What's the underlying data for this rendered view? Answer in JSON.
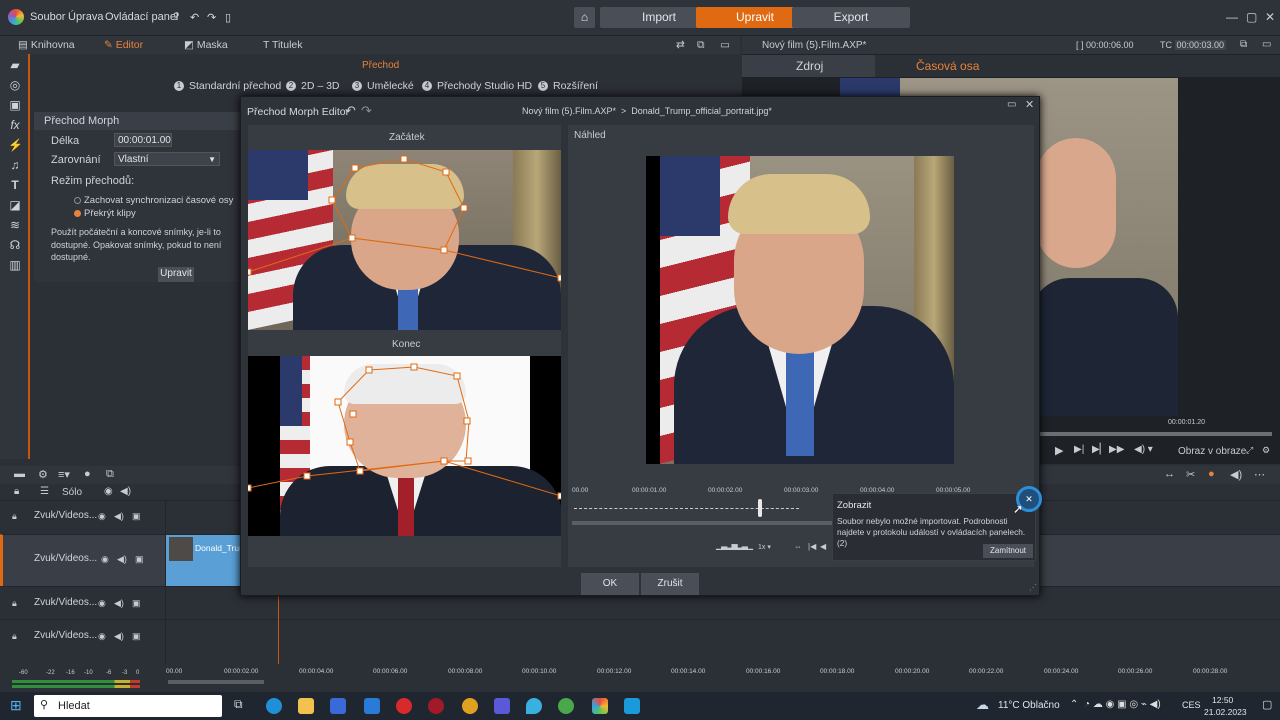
{
  "menu": {
    "file": "Soubor",
    "edit": "Úprava",
    "control_panel": "Ovládací panel"
  },
  "modes": {
    "import": "Import",
    "edit": "Upravit",
    "export": "Export"
  },
  "tabs": {
    "library": "Knihovna",
    "editor": "Editor",
    "mask": "Maska",
    "title": "Titulek"
  },
  "transition_label": "Přechod",
  "subtabs": [
    {
      "num": "1",
      "label": "Standardní přechod"
    },
    {
      "num": "2",
      "label": "2D – 3D"
    },
    {
      "num": "3",
      "label": "Umělecké"
    },
    {
      "num": "4",
      "label": "Přechody Studio HD"
    },
    {
      "num": "5",
      "label": "Rozšíření"
    }
  ],
  "props": {
    "header": "Přechod Morph",
    "length_label": "Délka",
    "length_value": "00:00:01.00",
    "align_label": "Zarovnání",
    "align_value": "Vlastní",
    "mode_label": "Režim přechodů:",
    "opt1": "Zachovat synchronizaci časové osy",
    "opt2": "Překrýt klipy",
    "note": "Použít počáteční a koncové snímky, je-li to dostupné. Opakovat snímky, pokud to není dostupné.",
    "edit_btn": "Upravit"
  },
  "preview": {
    "title": "Nový film (5).Film.AXP*",
    "timecode1": "00:00:06.00",
    "tc_label": "TC",
    "timecode2": "00:00:03.00",
    "tab_source": "Zdroj",
    "tab_timeline": "Časová osa",
    "time": "00:00:01.20",
    "view_label": "Obraz v obraze"
  },
  "dialog": {
    "title": "Přechod Morph Editor",
    "crumb1": "Nový film (5).Film.AXP*",
    "crumb2": "Donald_Trump_official_portrait.jpg*",
    "start_label": "Začátek",
    "end_label": "Konec",
    "preview_label": "Náhled",
    "ticks": [
      "00.00",
      "00:00:01.00",
      "00:00:02.00",
      "00:00:03.00",
      "00:00:04.00",
      "00:00:05.00"
    ],
    "speed": "1x",
    "ok": "OK",
    "cancel": "Zrušit"
  },
  "notification": {
    "title": "Zobrazit",
    "text": "Soubor nebylo možné importovat. Podrobnosti najdete v protokolu událostí v ovládacích panelech. (2)",
    "dismiss": "Zamítnout"
  },
  "timeline": {
    "solo": "Sólo",
    "tracks": [
      "Zvuk/Videos...",
      "Zvuk/Videos...",
      "Zvuk/Videos...",
      "Zvuk/Videos..."
    ],
    "clip": "Donald_Trum",
    "ruler": [
      "00.00",
      "00:00:02.00",
      "00:00:04.00",
      "00:00:06.00",
      "00:00:08.00",
      "00:00:10.00",
      "00:00:12.00",
      "00:00:14.00",
      "00:00:16.00",
      "00:00:18.00",
      "00:00:20.00",
      "00:00:22.00",
      "00:00:24.00",
      "00:00:26.00",
      "00:00:28.00"
    ],
    "meter": [
      "-60",
      "-22",
      "-16",
      "-10",
      "-6",
      "-3",
      "0"
    ]
  },
  "taskbar": {
    "search": "Hledat",
    "weather": "11°C Oblačno",
    "lang": "CES",
    "time": "12:50",
    "date": "21.02.2023"
  },
  "colors": {
    "accent": "#e06a12",
    "bg": "#2b2f36",
    "clip": "#5a9fd6"
  }
}
